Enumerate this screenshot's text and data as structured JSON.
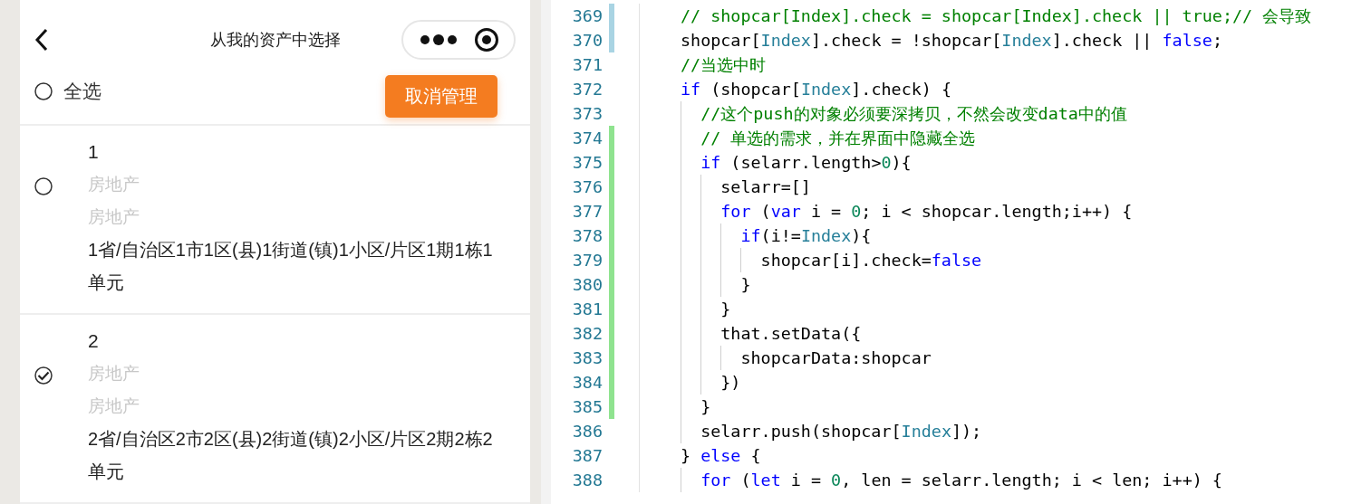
{
  "nav": {
    "title": "从我的资产中选择"
  },
  "select_all": {
    "label": "全选",
    "checked": false
  },
  "manage_button": "取消管理",
  "assets": [
    {
      "number": "1",
      "category": "房地产",
      "type": "房地产",
      "address": "1省/自治区1市1区(县)1街道(镇)1小区/片区1期1栋1单元",
      "selected": false
    },
    {
      "number": "2",
      "category": "房地产",
      "type": "房地产",
      "address": "2省/自治区2市2区(县)2街道(镇)2小区/片区2期2栋2单元",
      "selected": true
    }
  ],
  "editor": {
    "lines": [
      {
        "number": "369",
        "color": "#a9d4e3",
        "tokens": [
          {
            "kind": "comment",
            "text": "// shopcar[Index].check = shopcar[Index].check || true;// 会导致"
          }
        ]
      },
      {
        "number": "370",
        "color": "#a9d4e3",
        "tokens": [
          {
            "kind": "plain",
            "text": "shopcar["
          },
          {
            "kind": "type",
            "text": "Index"
          },
          {
            "kind": "plain",
            "text": "].check = !shopcar["
          },
          {
            "kind": "type",
            "text": "Index"
          },
          {
            "kind": "plain",
            "text": "].check || "
          },
          {
            "kind": "keyword",
            "text": "false"
          },
          {
            "kind": "plain",
            "text": ";"
          }
        ]
      },
      {
        "number": "371",
        "tokens": [
          {
            "kind": "comment",
            "text": "//当选中时"
          }
        ]
      },
      {
        "number": "372",
        "tokens": [
          {
            "kind": "keyword",
            "text": "if"
          },
          {
            "kind": "plain",
            "text": " (shopcar["
          },
          {
            "kind": "type",
            "text": "Index"
          },
          {
            "kind": "plain",
            "text": "].check) {"
          }
        ]
      },
      {
        "number": "373",
        "tokens": [
          {
            "kind": "comment",
            "text": "  //这个push的对象必须要深拷贝，不然会改变data中的值"
          }
        ]
      },
      {
        "number": "374",
        "color": "#8fe38f",
        "tokens": [
          {
            "kind": "comment",
            "text": "  // 单选的需求，并在界面中隐藏全选"
          }
        ]
      },
      {
        "number": "375",
        "color": "#8fe38f",
        "tokens": [
          {
            "kind": "keyword",
            "text": "  if"
          },
          {
            "kind": "plain",
            "text": " (selarr.length>"
          },
          {
            "kind": "number",
            "text": "0"
          },
          {
            "kind": "plain",
            "text": "){"
          }
        ]
      },
      {
        "number": "376",
        "color": "#8fe38f",
        "tokens": [
          {
            "kind": "plain",
            "text": "    selarr=[]"
          }
        ]
      },
      {
        "number": "377",
        "color": "#8fe38f",
        "tokens": [
          {
            "kind": "keyword",
            "text": "    for"
          },
          {
            "kind": "plain",
            "text": " ("
          },
          {
            "kind": "keyword",
            "text": "var"
          },
          {
            "kind": "plain",
            "text": " i = "
          },
          {
            "kind": "number",
            "text": "0"
          },
          {
            "kind": "plain",
            "text": "; i < shopcar.length;i++) {"
          }
        ]
      },
      {
        "number": "378",
        "color": "#8fe38f",
        "tokens": [
          {
            "kind": "keyword",
            "text": "      if"
          },
          {
            "kind": "plain",
            "text": "(i!="
          },
          {
            "kind": "type",
            "text": "Index"
          },
          {
            "kind": "plain",
            "text": "){"
          }
        ]
      },
      {
        "number": "379",
        "color": "#8fe38f",
        "tokens": [
          {
            "kind": "plain",
            "text": "        shopcar[i].check="
          },
          {
            "kind": "keyword",
            "text": "false"
          }
        ]
      },
      {
        "number": "380",
        "color": "#8fe38f",
        "tokens": [
          {
            "kind": "plain",
            "text": "      }"
          }
        ]
      },
      {
        "number": "381",
        "color": "#8fe38f",
        "tokens": [
          {
            "kind": "plain",
            "text": "    }"
          }
        ]
      },
      {
        "number": "382",
        "color": "#8fe38f",
        "tokens": [
          {
            "kind": "plain",
            "text": "    that.setData({"
          }
        ]
      },
      {
        "number": "383",
        "color": "#8fe38f",
        "tokens": [
          {
            "kind": "plain",
            "text": "      shopcarData:shopcar"
          }
        ]
      },
      {
        "number": "384",
        "color": "#8fe38f",
        "tokens": [
          {
            "kind": "plain",
            "text": "    })"
          }
        ]
      },
      {
        "number": "385",
        "color": "#8fe38f",
        "tokens": [
          {
            "kind": "plain",
            "text": "  }"
          }
        ]
      },
      {
        "number": "386",
        "tokens": [
          {
            "kind": "plain",
            "text": "  selarr.push(shopcar["
          },
          {
            "kind": "type",
            "text": "Index"
          },
          {
            "kind": "plain",
            "text": "]);"
          }
        ]
      },
      {
        "number": "387",
        "tokens": [
          {
            "kind": "plain",
            "text": "} "
          },
          {
            "kind": "keyword",
            "text": "else"
          },
          {
            "kind": "plain",
            "text": " {"
          }
        ]
      },
      {
        "number": "388",
        "tokens": [
          {
            "kind": "keyword",
            "text": "  for"
          },
          {
            "kind": "plain",
            "text": " ("
          },
          {
            "kind": "keyword",
            "text": "let"
          },
          {
            "kind": "plain",
            "text": " i = "
          },
          {
            "kind": "number",
            "text": "0"
          },
          {
            "kind": "plain",
            "text": ", len = selarr.length; i < len; i++) {"
          }
        ]
      }
    ]
  }
}
